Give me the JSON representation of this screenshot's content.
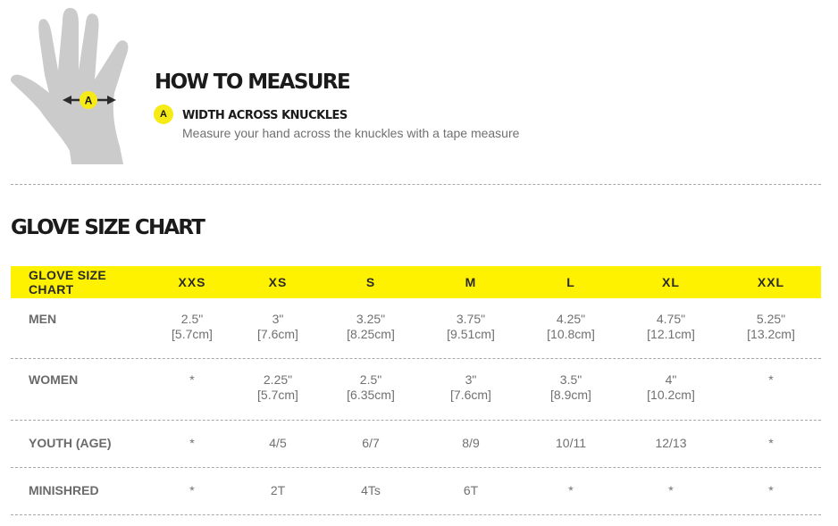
{
  "how_to_measure": {
    "title": "HOW TO MEASURE",
    "marker": "A",
    "measurement_name": "WIDTH ACROSS KNUCKLES",
    "measurement_description": "Measure your hand across the knuckles with a tape measure",
    "hand_icon": "hand-diagram-icon",
    "accent_color": "#f6eb16"
  },
  "size_chart": {
    "title": "GLOVE SIZE CHART",
    "header_color": "#fff200",
    "header_label": "GLOVE SIZE CHART",
    "sizes": [
      "XXS",
      "XS",
      "S",
      "M",
      "L",
      "XL",
      "XXL"
    ],
    "rows": [
      {
        "label": "MEN",
        "cells": [
          {
            "inch": "2.5\"",
            "cm": "[5.7cm]"
          },
          {
            "inch": "3\"",
            "cm": "[7.6cm]"
          },
          {
            "inch": "3.25\"",
            "cm": "[8.25cm]"
          },
          {
            "inch": "3.75\"",
            "cm": "[9.51cm]"
          },
          {
            "inch": "4.25\"",
            "cm": "[10.8cm]"
          },
          {
            "inch": "4.75\"",
            "cm": "[12.1cm]"
          },
          {
            "inch": "5.25\"",
            "cm": "[13.2cm]"
          }
        ]
      },
      {
        "label": "WOMEN",
        "cells": [
          {
            "inch": "*",
            "cm": ""
          },
          {
            "inch": "2.25\"",
            "cm": "[5.7cm]"
          },
          {
            "inch": "2.5\"",
            "cm": "[6.35cm]"
          },
          {
            "inch": "3\"",
            "cm": "[7.6cm]"
          },
          {
            "inch": "3.5\"",
            "cm": "[8.9cm]"
          },
          {
            "inch": "4\"",
            "cm": "[10.2cm]"
          },
          {
            "inch": "*",
            "cm": ""
          }
        ]
      },
      {
        "label": "YOUTH (AGE)",
        "cells": [
          {
            "inch": "*",
            "cm": ""
          },
          {
            "inch": "4/5",
            "cm": ""
          },
          {
            "inch": "6/7",
            "cm": ""
          },
          {
            "inch": "8/9",
            "cm": ""
          },
          {
            "inch": "10/11",
            "cm": ""
          },
          {
            "inch": "12/13",
            "cm": ""
          },
          {
            "inch": "*",
            "cm": ""
          }
        ]
      },
      {
        "label": "MINISHRED",
        "cells": [
          {
            "inch": "*",
            "cm": ""
          },
          {
            "inch": "2T",
            "cm": ""
          },
          {
            "inch": "4Ts",
            "cm": ""
          },
          {
            "inch": "6T",
            "cm": ""
          },
          {
            "inch": "*",
            "cm": ""
          },
          {
            "inch": "*",
            "cm": ""
          },
          {
            "inch": "*",
            "cm": ""
          }
        ]
      }
    ]
  }
}
